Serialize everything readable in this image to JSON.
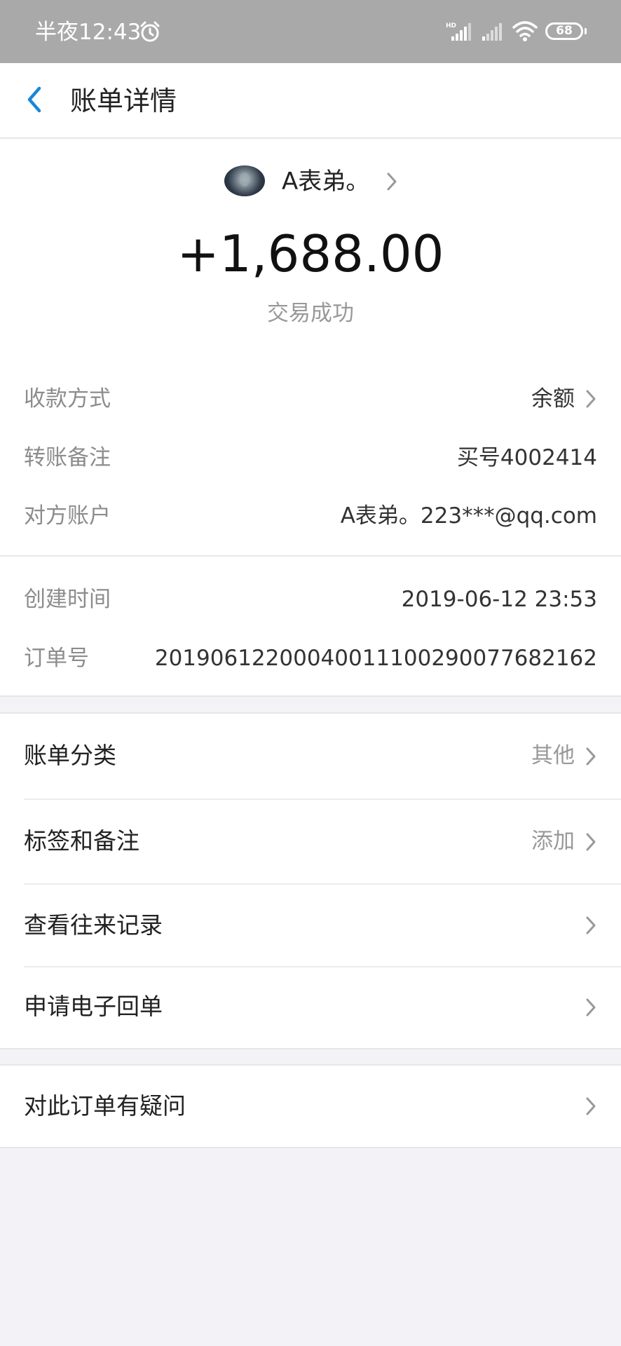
{
  "status_bar": {
    "time": "半夜12:43",
    "battery": "68",
    "icons": [
      "alarm-icon",
      "signal-hd-icon",
      "signal-icon",
      "wifi-icon",
      "battery-icon"
    ]
  },
  "nav": {
    "title": "账单详情",
    "back_icon": "chevron-left-icon"
  },
  "payee": {
    "name": "A表弟。"
  },
  "amount": "+1,688.00",
  "trade_status": "交易成功",
  "details": [
    {
      "label": "收款方式",
      "value": "余额"
    },
    {
      "label": "转账备注",
      "value": "买号4002414"
    },
    {
      "label": "对方账户",
      "value": "A表弟。223***@qq.com"
    },
    {
      "label": "创建时间",
      "value": "2019-06-12 23:53"
    },
    {
      "label": "订单号",
      "value": "20190612200040011100290077682162"
    }
  ],
  "menu": [
    {
      "label": "账单分类",
      "value": "其他"
    },
    {
      "label": "标签和备注",
      "value": "添加"
    },
    {
      "label": "查看往来记录",
      "value": ""
    },
    {
      "label": "申请电子回单",
      "value": ""
    }
  ],
  "menu2": [
    {
      "label": "对此订单有疑问",
      "value": ""
    }
  ],
  "colors": {
    "status_bar_bg": "#a9a9a9",
    "accent_blue": "#1a86d8",
    "page_bg": "#f3f3f7",
    "label_gray": "#8c8c8c"
  }
}
